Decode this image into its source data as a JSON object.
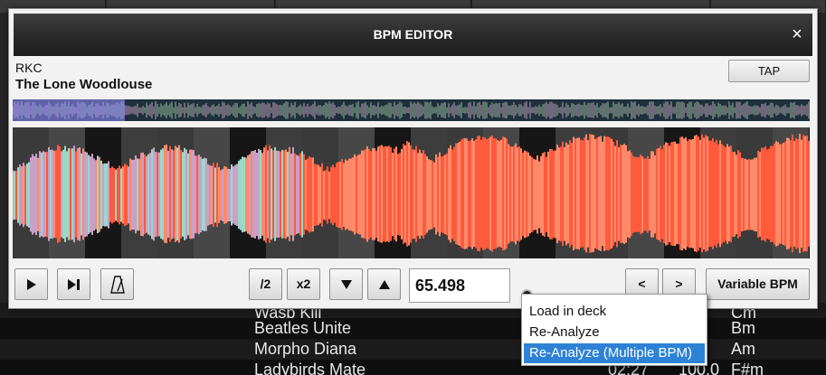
{
  "dialog": {
    "title": "BPM EDITOR",
    "close_icon": "×"
  },
  "track": {
    "artist": "RKC",
    "title": "The Lone Woodlouse"
  },
  "buttons": {
    "tap": "TAP",
    "play_icon": "play-icon",
    "skip_icon": "skip-to-end-icon",
    "metronome_icon": "metronome-icon",
    "half": "/2",
    "double": "x2",
    "down_icon": "triangle-down-icon",
    "up_icon": "triangle-up-icon",
    "prev": "<",
    "next": ">",
    "variable_bpm": "Variable BPM"
  },
  "bpm_value": "65.498",
  "context_menu": {
    "items": [
      "Load in deck",
      "Re-Analyze",
      "Re-Analyze (Multiple BPM)"
    ],
    "selected_index": 2
  },
  "track_list": [
    {
      "title": "Wasp Kill",
      "time": "",
      "bpm": "0",
      "key": "Cm"
    },
    {
      "title": "Beatles Unite",
      "time": "",
      "bpm": ".0",
      "key": "Bm"
    },
    {
      "title": "Morpho Diana",
      "time": "",
      "bpm": ".0",
      "key": "Am"
    },
    {
      "title": "Ladybirds Mate",
      "time": "02:27",
      "bpm": "100.0",
      "key": "F#m"
    }
  ],
  "colors": {
    "accent_selected": "#2e82d6",
    "wave_hot": "#ff5a3c",
    "wave_cool": "#9ad8c8",
    "overview_bg": "#1f2f3c"
  }
}
